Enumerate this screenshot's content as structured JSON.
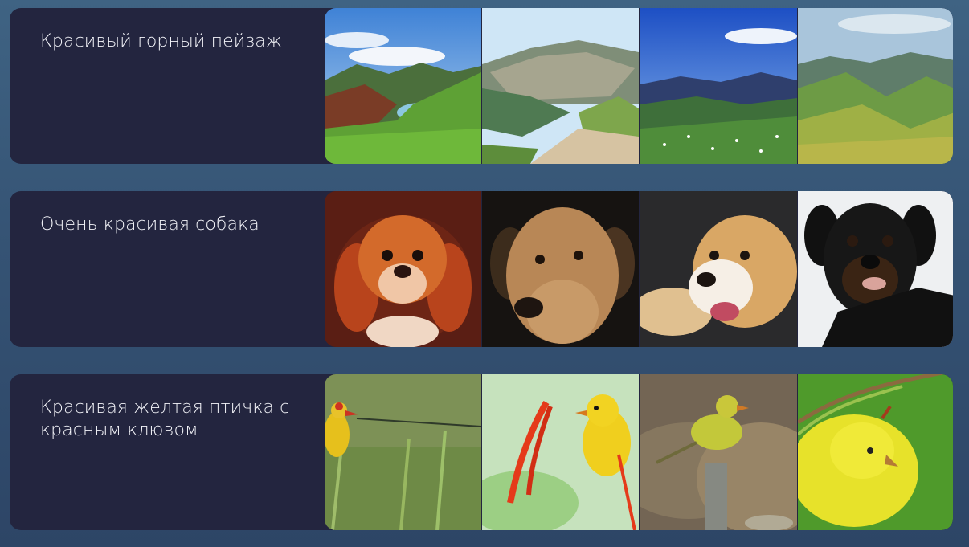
{
  "rows": [
    {
      "prompt": "Красивый горный пейзаж",
      "images": [
        {
          "icon": "mountain-lake-image"
        },
        {
          "icon": "mountain-valley-image"
        },
        {
          "icon": "mountain-meadow-image"
        },
        {
          "icon": "green-hills-image"
        }
      ]
    },
    {
      "prompt": "Очень красивая собака",
      "images": [
        {
          "icon": "spaniel-dog-image"
        },
        {
          "icon": "tan-dog-image"
        },
        {
          "icon": "golden-retriever-image"
        },
        {
          "icon": "black-dog-image"
        }
      ]
    },
    {
      "prompt": "Красивая желтая птичка с красным клювом",
      "images": [
        {
          "icon": "bird-on-grass-image"
        },
        {
          "icon": "bird-with-red-flower-image"
        },
        {
          "icon": "bird-on-post-image"
        },
        {
          "icon": "yellow-bird-closeup-image"
        }
      ]
    }
  ],
  "colors": {
    "background_top": "#3f6383",
    "background_bottom": "#2d4566",
    "card": "#23253f",
    "text": "#f2f3f8"
  }
}
